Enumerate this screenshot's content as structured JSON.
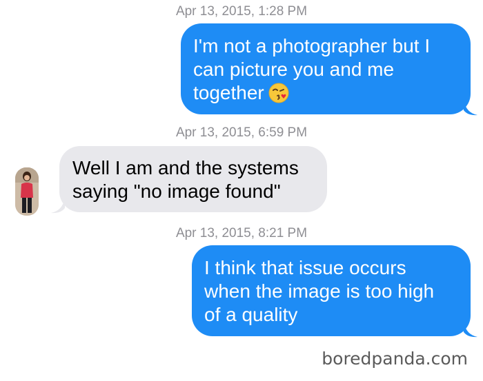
{
  "thread": {
    "messages": [
      {
        "timestamp": "Apr 13, 2015, 1:28 PM",
        "direction": "outgoing",
        "lines": [
          "I'm not a photographer but I",
          "can picture you and me",
          "together"
        ],
        "emoji": "kissing-face-emoji"
      },
      {
        "timestamp": "Apr 13, 2015, 6:59 PM",
        "direction": "incoming",
        "lines": [
          "Well I am and the systems",
          "saying \"no image found\""
        ]
      },
      {
        "timestamp": "Apr 13, 2015, 8:21 PM",
        "direction": "outgoing",
        "lines": [
          "I think that issue occurs",
          "when the image is too high",
          "of a quality"
        ]
      }
    ]
  },
  "watermark": "boredpanda.com",
  "colors": {
    "outgoing_bubble": "#1e8cf5",
    "incoming_bubble": "#e8e8ec",
    "timestamp_text": "#8e8e93"
  }
}
